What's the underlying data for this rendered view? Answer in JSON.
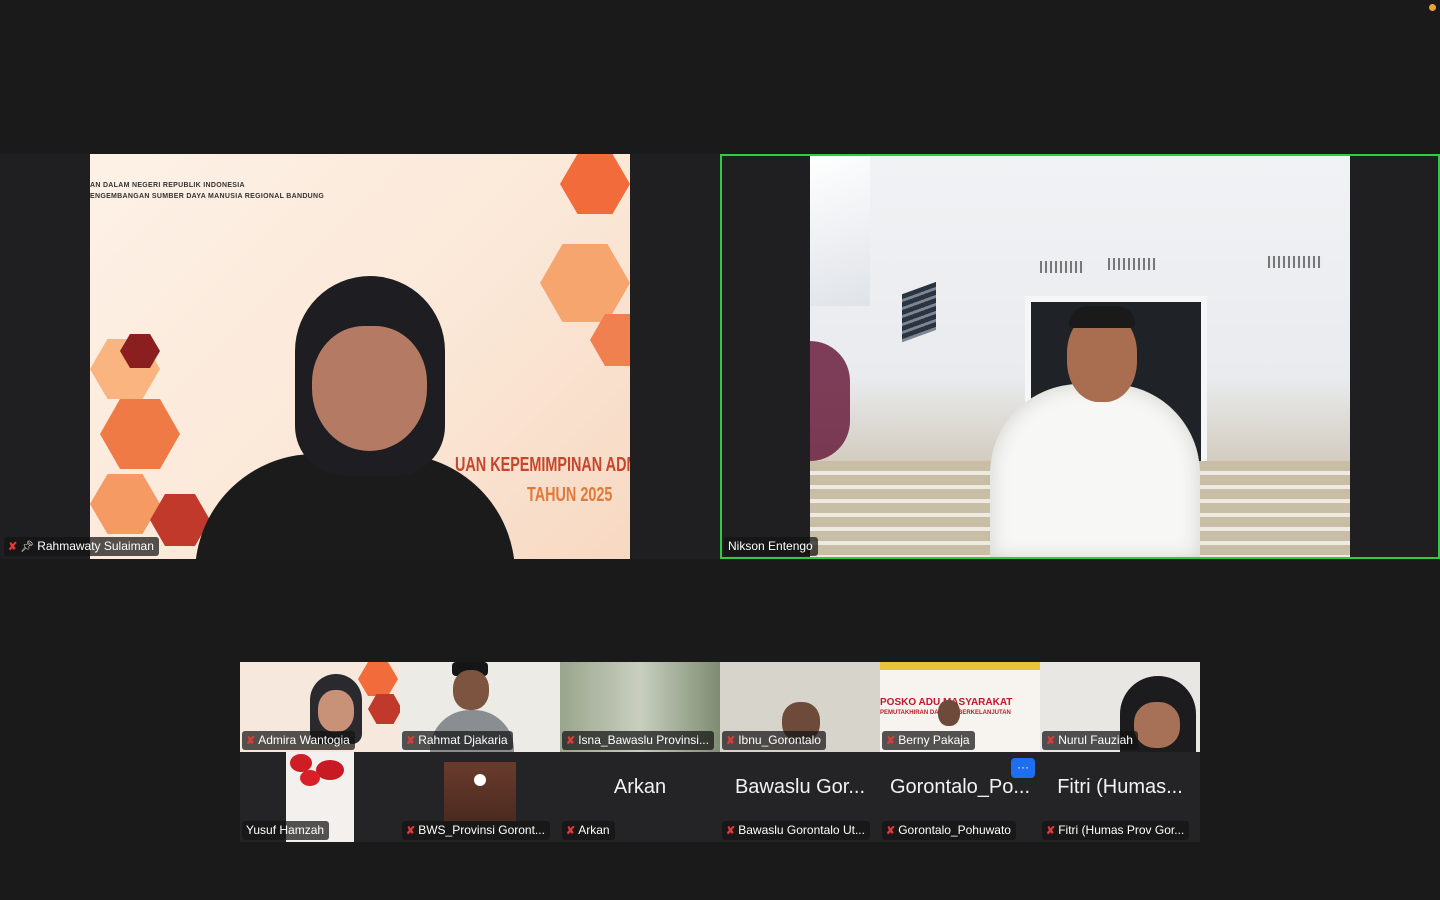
{
  "main_tiles": [
    {
      "name": "Rahmawaty Sulaiman",
      "muted": true,
      "pinned": true,
      "slide_header": [
        "AN DALAM NEGERI REPUBLIK INDONESIA",
        "ENGEMBANGAN SUMBER DAYA MANUSIA REGIONAL BANDUNG"
      ],
      "slide_title": [
        "UAN KEPEMIMPINAN ADM",
        "TAHUN 2025"
      ]
    },
    {
      "name": "Nikson Entengo",
      "muted": false,
      "active_speaker": true
    }
  ],
  "gallery": [
    {
      "name": "Admira Wantogia",
      "muted": true,
      "video": true
    },
    {
      "name": "Rahmat Djakaria",
      "muted": true,
      "video": true
    },
    {
      "name": "Isna_Bawaslu Provinsi...",
      "muted": true,
      "video": true
    },
    {
      "name": "Ibnu_Gorontalo",
      "muted": true,
      "video": true
    },
    {
      "name": "Berny Pakaja",
      "muted": true,
      "video": true,
      "banner": [
        "POSKO ADU MASYARAKAT",
        "PEMUTAKHIRAN DA MILIH BERKELANJUTAN"
      ]
    },
    {
      "name": "Nurul Fauziah",
      "muted": true,
      "video": true
    },
    {
      "name": "Yusuf Hamzah",
      "muted": false,
      "video": true
    },
    {
      "name": "BWS_Provinsi Goront...",
      "muted": true,
      "video": true
    },
    {
      "name": "Arkan",
      "display": "Arkan",
      "muted": true,
      "video": false
    },
    {
      "name": "Bawaslu Gorontalo Ut...",
      "display": "Bawaslu Gor...",
      "muted": true,
      "video": false
    },
    {
      "name": "Gorontalo_Pohuwato",
      "display": "Gorontalo_Po...",
      "muted": true,
      "video": false
    },
    {
      "name": "Fitri (Humas Prov Gor...",
      "display": "Fitri (Humas...",
      "muted": true,
      "video": false
    }
  ],
  "more_button": "···",
  "colors": {
    "background": "#1a1a1a",
    "active_border": "#2ecc40",
    "muted": "#e53935",
    "more": "#1e6ff0"
  }
}
